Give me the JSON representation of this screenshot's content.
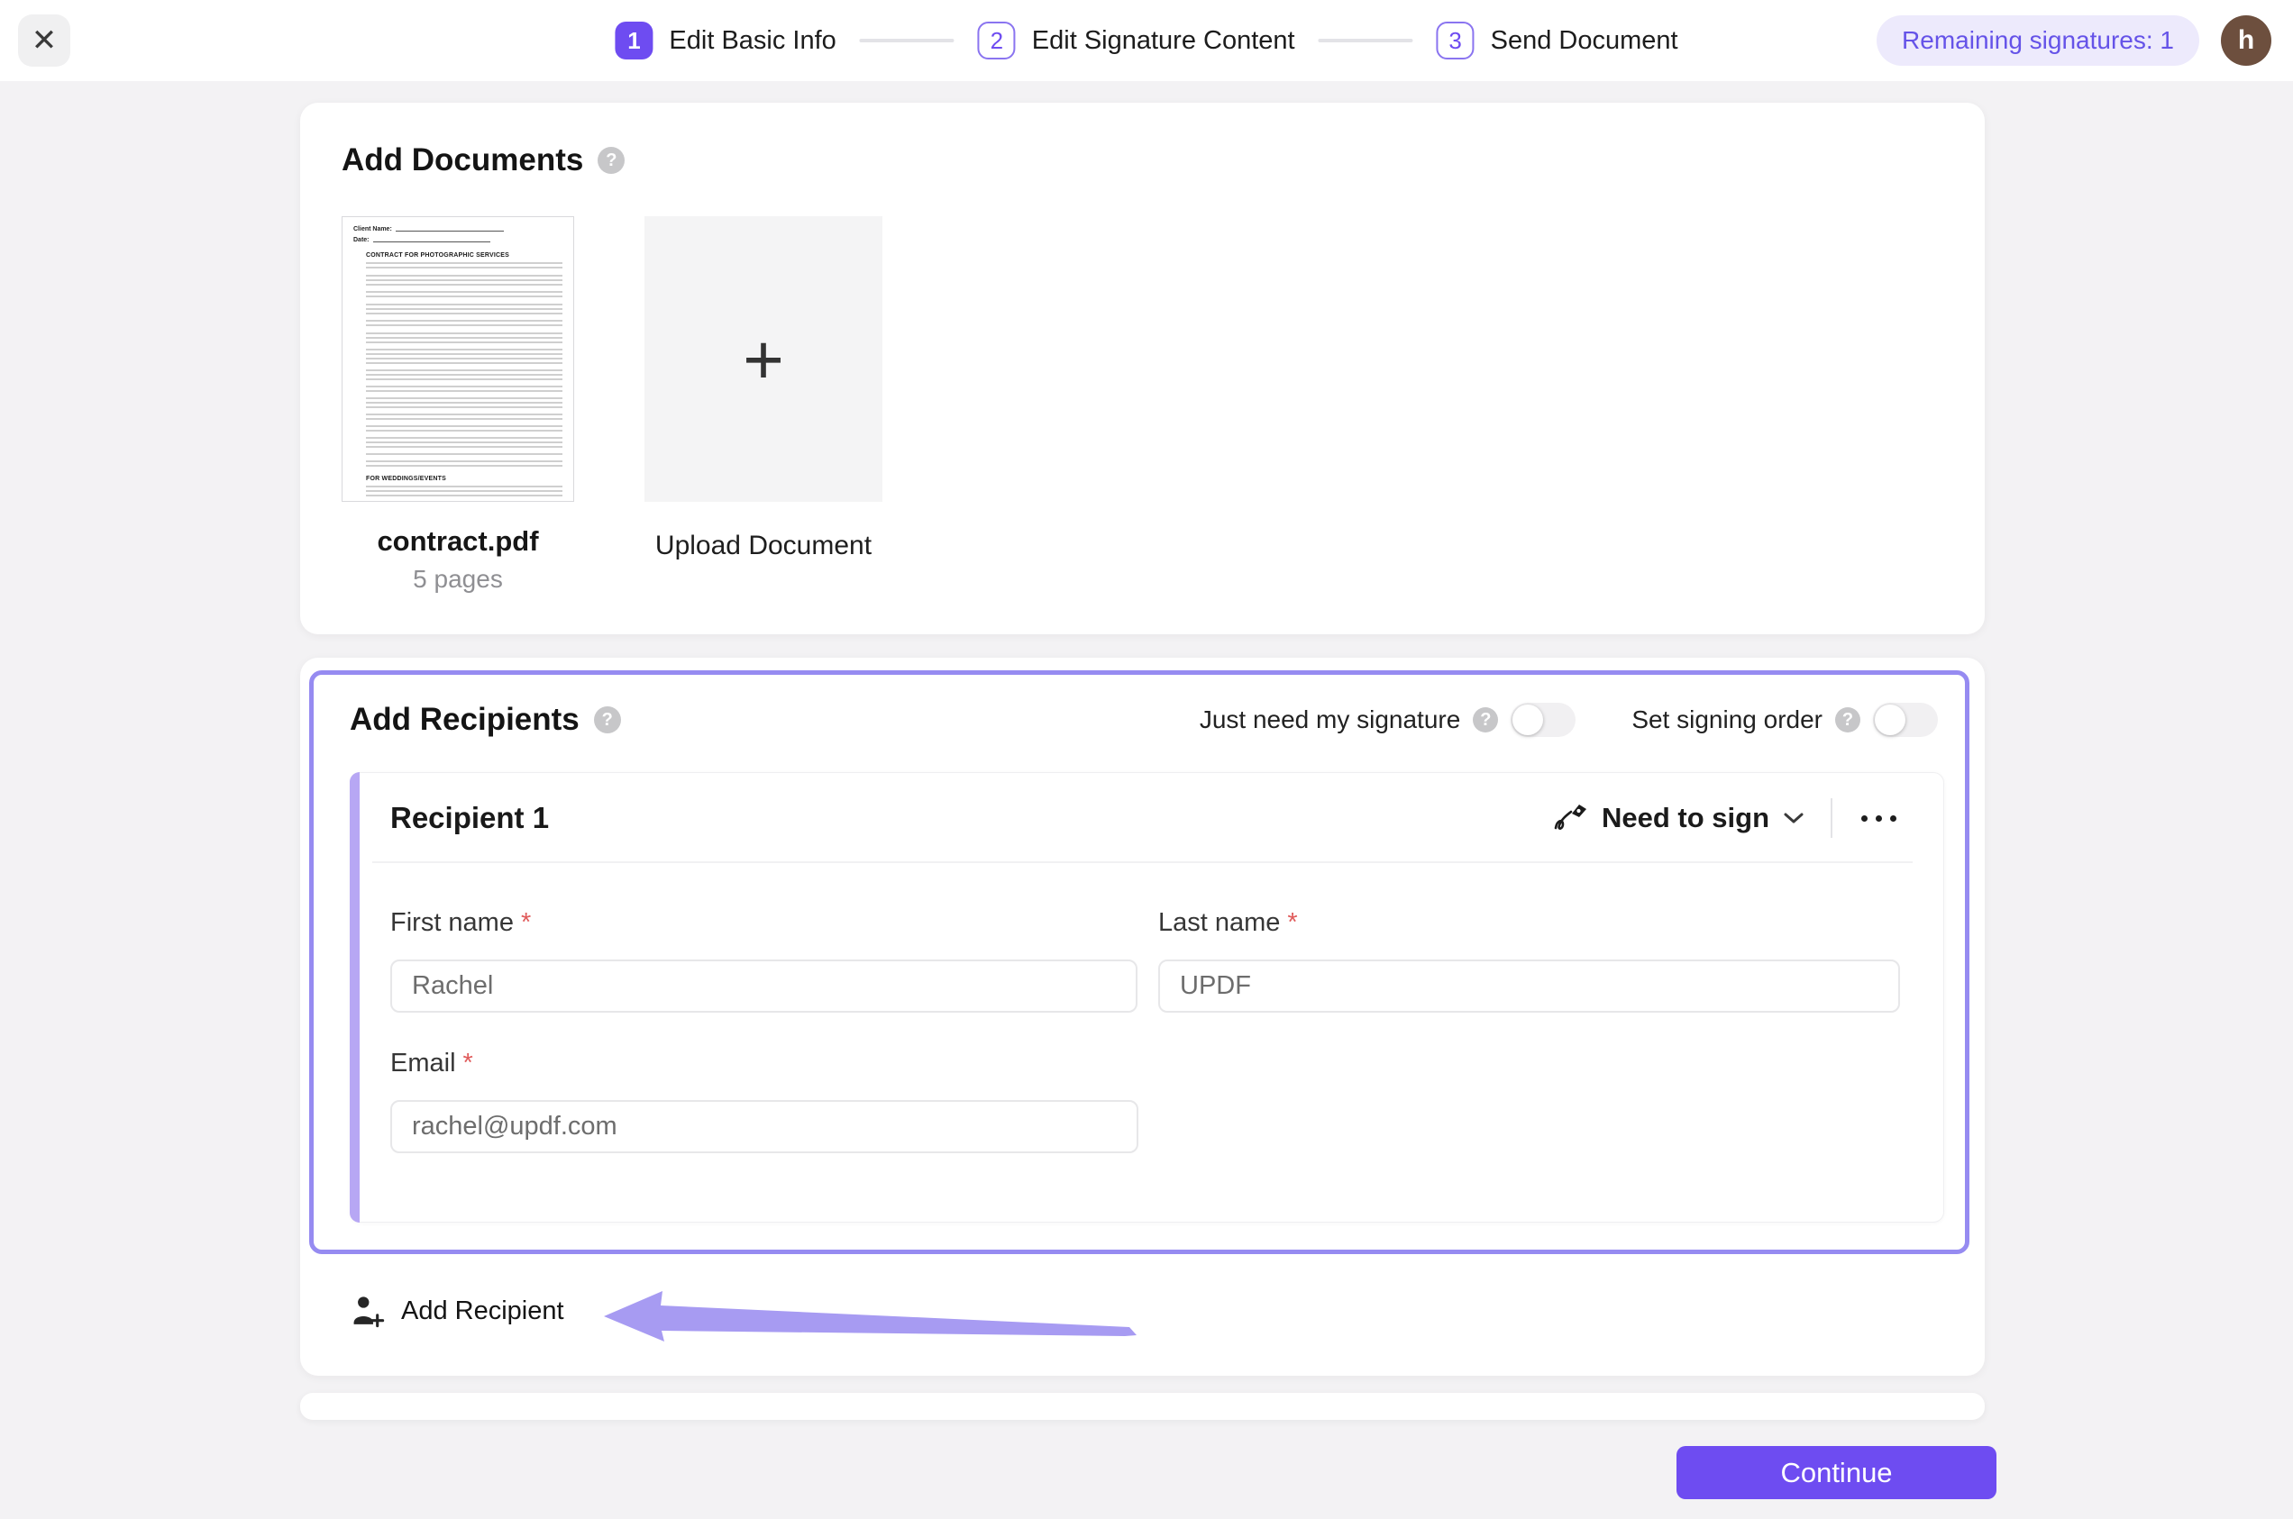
{
  "topbar": {
    "close_icon": "✕",
    "steps": [
      {
        "number": "1",
        "label": "Edit Basic Info",
        "state": "active"
      },
      {
        "number": "2",
        "label": "Edit Signature Content",
        "state": "upcoming"
      },
      {
        "number": "3",
        "label": "Send Document",
        "state": "upcoming"
      }
    ],
    "remaining_badge": "Remaining signatures: 1",
    "avatar_initial": "h"
  },
  "documents": {
    "title": "Add Documents",
    "help_icon": "?",
    "doc": {
      "name": "contract.pdf",
      "pages": "5 pages",
      "thumb": {
        "client_name_label": "Client Name:",
        "date_label": "Date:",
        "heading": "CONTRACT FOR PHOTOGRAPHIC SERVICES",
        "subheading": "FOR WEDDINGS/EVENTS"
      }
    },
    "upload": {
      "plus": "+",
      "label": "Upload Document"
    }
  },
  "recipients": {
    "title": "Add Recipients",
    "help_icon": "?",
    "toggles": [
      {
        "label": "Just need my signature",
        "state": "off"
      },
      {
        "label": "Set signing order",
        "state": "off"
      }
    ],
    "recipient": {
      "name": "Recipient 1",
      "role": "Need to sign",
      "fields": [
        {
          "label": "First name",
          "required": "*",
          "value": "Rachel"
        },
        {
          "label": "Last name",
          "required": "*",
          "value": "UPDF"
        },
        {
          "label": "Email",
          "required": "*",
          "value": "rachel@updf.com"
        }
      ]
    },
    "add_recipient_label": "Add Recipient"
  },
  "footer": {
    "continue_label": "Continue"
  },
  "colors": {
    "accent": "#6e4cf1",
    "highlight_border": "#968bf1",
    "accent_bar": "#b7a7f4",
    "arrow": "#a79bf2",
    "badge_bg": "#edeafc",
    "badge_text": "#6553e8",
    "avatar_bg": "#6d4f3e",
    "required_star": "#e05b5b"
  }
}
